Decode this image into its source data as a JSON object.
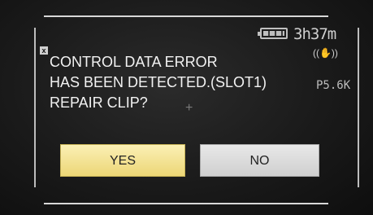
{
  "status": {
    "battery_icon": "battery-icon",
    "time_remaining": "3h37m",
    "stabilizer_icon": "image-stabilizer-icon",
    "stabilizer_text": "((✋))",
    "setting": "P5.6K"
  },
  "dialog": {
    "icon": "x",
    "message_lines": [
      "CONTROL DATA ERROR",
      "HAS BEEN DETECTED.(SLOT1)",
      "REPAIR CLIP?"
    ],
    "crosshair": "+"
  },
  "buttons": {
    "yes_label": "YES",
    "no_label": "NO",
    "selected": "YES"
  },
  "colors": {
    "selected_button": "#f6e69a",
    "unselected_button": "#dcdcdc",
    "text": "#f2f2f2",
    "background": "#1a1a1a"
  }
}
